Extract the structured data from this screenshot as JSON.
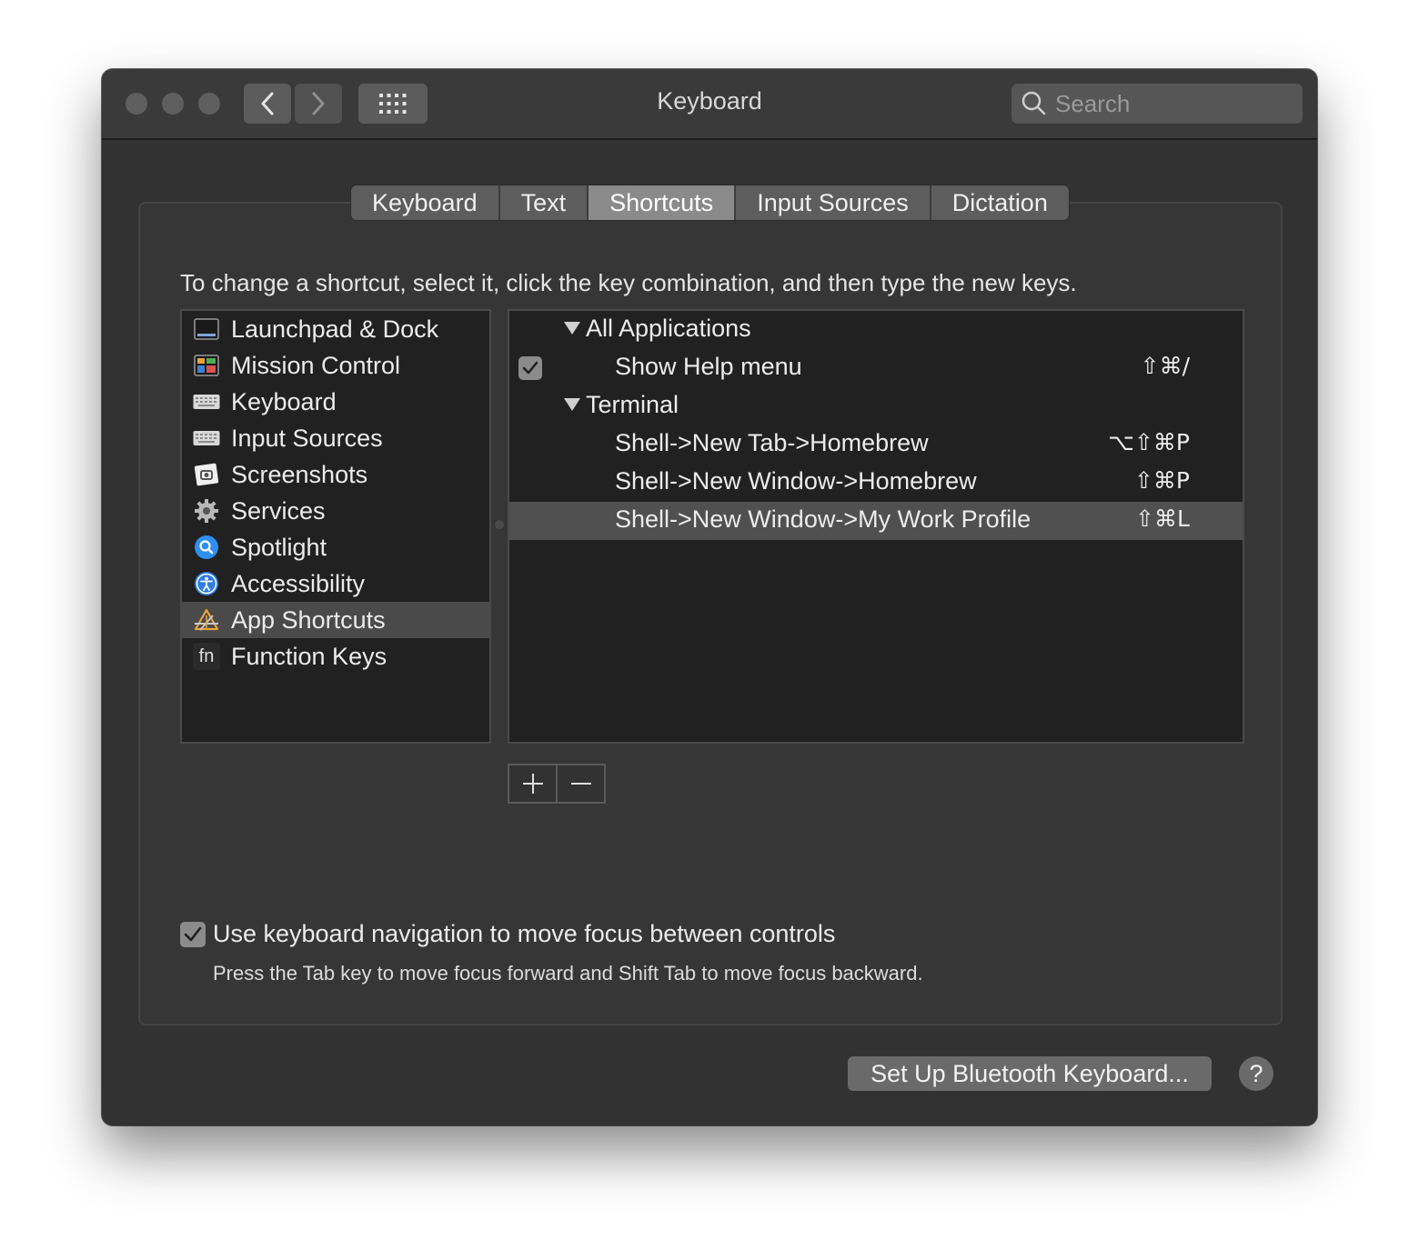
{
  "window": {
    "title": "Keyboard"
  },
  "toolbar": {
    "search_placeholder": "Search"
  },
  "tabs": [
    {
      "label": "Keyboard"
    },
    {
      "label": "Text"
    },
    {
      "label": "Shortcuts",
      "active": true
    },
    {
      "label": "Input Sources"
    },
    {
      "label": "Dictation"
    }
  ],
  "instruction": "To change a shortcut, select it, click the key combination, and then type the new keys.",
  "sidebar": {
    "items": [
      {
        "label": "Launchpad & Dock",
        "icon": "launchpad-dock-icon"
      },
      {
        "label": "Mission Control",
        "icon": "mission-control-icon"
      },
      {
        "label": "Keyboard",
        "icon": "keyboard-icon"
      },
      {
        "label": "Input Sources",
        "icon": "input-sources-icon"
      },
      {
        "label": "Screenshots",
        "icon": "screenshots-icon"
      },
      {
        "label": "Services",
        "icon": "gear-icon"
      },
      {
        "label": "Spotlight",
        "icon": "spotlight-icon"
      },
      {
        "label": "Accessibility",
        "icon": "accessibility-icon"
      },
      {
        "label": "App Shortcuts",
        "icon": "app-shortcuts-icon",
        "selected": true
      },
      {
        "label": "Function Keys",
        "icon": "fn-icon",
        "icon_text": "fn"
      }
    ]
  },
  "shortcuts": {
    "groups": [
      {
        "label": "All Applications",
        "items": [
          {
            "name": "Show Help menu",
            "keys": "⇧⌘/",
            "checked": true
          }
        ]
      },
      {
        "label": "Terminal",
        "items": [
          {
            "name": "Shell->New Tab->Homebrew",
            "keys": "⌥⇧⌘P"
          },
          {
            "name": "Shell->New Window->Homebrew",
            "keys": "⇧⌘P"
          },
          {
            "name": "Shell->New Window->My Work Profile",
            "keys": "⇧⌘L",
            "selected": true
          }
        ]
      }
    ]
  },
  "buttons": {
    "add": "+",
    "remove": "—"
  },
  "keyboard_navigation": {
    "label": "Use keyboard navigation to move focus between controls",
    "checked": true,
    "help": "Press the Tab key to move focus forward and Shift Tab to move focus backward."
  },
  "footer": {
    "bluetooth_button": "Set Up Bluetooth Keyboard...",
    "help_button": "?"
  }
}
